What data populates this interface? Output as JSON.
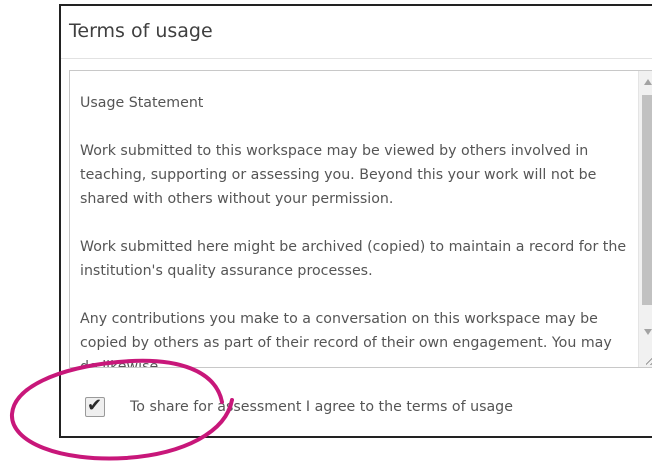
{
  "dialog": {
    "title": "Terms of usage"
  },
  "statement": {
    "heading": "Usage Statement",
    "paragraphs": [
      "Work submitted to this workspace may be viewed by others involved in teaching, supporting or assessing you. Beyond this your work will not be shared with others without your permission.",
      "Work submitted here might be archived (copied) to maintain a record for the institution's quality assurance processes.",
      "Any contributions you make to a conversation on this workspace may be copied by others as part of their record of their own engagement. You may do likewise."
    ]
  },
  "agreement": {
    "checked": true,
    "label": "To share for assessment I agree to the terms of usage"
  },
  "annotation": {
    "color": "#c8177a",
    "shape": "circle-highlight"
  }
}
